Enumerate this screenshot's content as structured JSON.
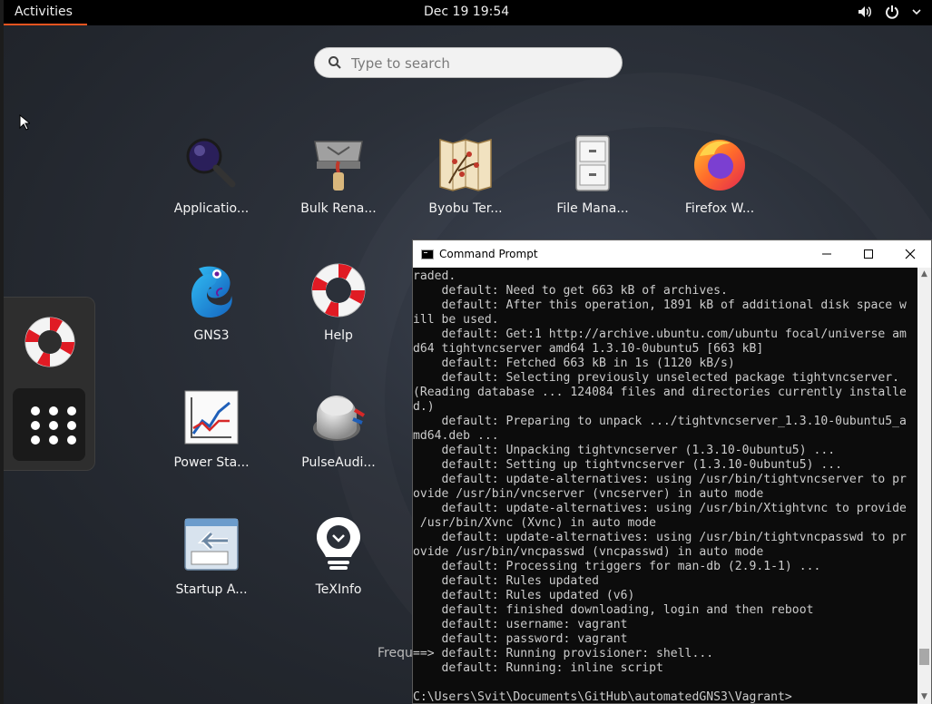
{
  "topbar": {
    "activities": "Activities",
    "clock": "Dec 19  19:54"
  },
  "search": {
    "placeholder": "Type to search"
  },
  "apps": [
    {
      "label": "Applicatio...",
      "icon": "magnifier-icon"
    },
    {
      "label": "Bulk Rena...",
      "icon": "bulk-rename-icon"
    },
    {
      "label": "Byobu Ter...",
      "icon": "byobu-icon"
    },
    {
      "label": "File Mana...",
      "icon": "file-cabinet-icon"
    },
    {
      "label": "Firefox W...",
      "icon": "firefox-icon"
    },
    {
      "label": "GNS3",
      "icon": "gns3-chameleon-icon"
    },
    {
      "label": "Help",
      "icon": "lifebuoy-icon"
    },
    {
      "label": "Power Sta...",
      "icon": "power-stats-chart-icon"
    },
    {
      "label": "PulseAudi...",
      "icon": "volume-knob-icon"
    },
    {
      "label": "Startup A...",
      "icon": "startup-apps-icon"
    },
    {
      "label": "TeXInfo",
      "icon": "lightbulb-icon"
    }
  ],
  "frequent_label": "Frequ",
  "terminal": {
    "title": "Command Prompt",
    "lines": [
      "raded.",
      "    default: Need to get 663 kB of archives.",
      "    default: After this operation, 1891 kB of additional disk space w",
      "ill be used.",
      "    default: Get:1 http://archive.ubuntu.com/ubuntu focal/universe am",
      "d64 tightvncserver amd64 1.3.10-0ubuntu5 [663 kB]",
      "    default: Fetched 663 kB in 1s (1120 kB/s)",
      "    default: Selecting previously unselected package tightvncserver.",
      "(Reading database ... 124084 files and directories currently installe",
      "d.)",
      "    default: Preparing to unpack .../tightvncserver_1.3.10-0ubuntu5_a",
      "md64.deb ...",
      "    default: Unpacking tightvncserver (1.3.10-0ubuntu5) ...",
      "    default: Setting up tightvncserver (1.3.10-0ubuntu5) ...",
      "    default: update-alternatives: using /usr/bin/tightvncserver to pr",
      "ovide /usr/bin/vncserver (vncserver) in auto mode",
      "    default: update-alternatives: using /usr/bin/Xtightvnc to provide",
      " /usr/bin/Xvnc (Xvnc) in auto mode",
      "    default: update-alternatives: using /usr/bin/tightvncpasswd to pr",
      "ovide /usr/bin/vncpasswd (vncpasswd) in auto mode",
      "    default: Processing triggers for man-db (2.9.1-1) ...",
      "    default: Rules updated",
      "    default: Rules updated (v6)",
      "    default: finished downloading, login and then reboot",
      "    default: username: vagrant",
      "    default: password: vagrant",
      "==> default: Running provisioner: shell...",
      "    default: Running: inline script",
      "",
      "C:\\Users\\Svit\\Documents\\GitHub\\automatedGNS3\\Vagrant>"
    ]
  }
}
